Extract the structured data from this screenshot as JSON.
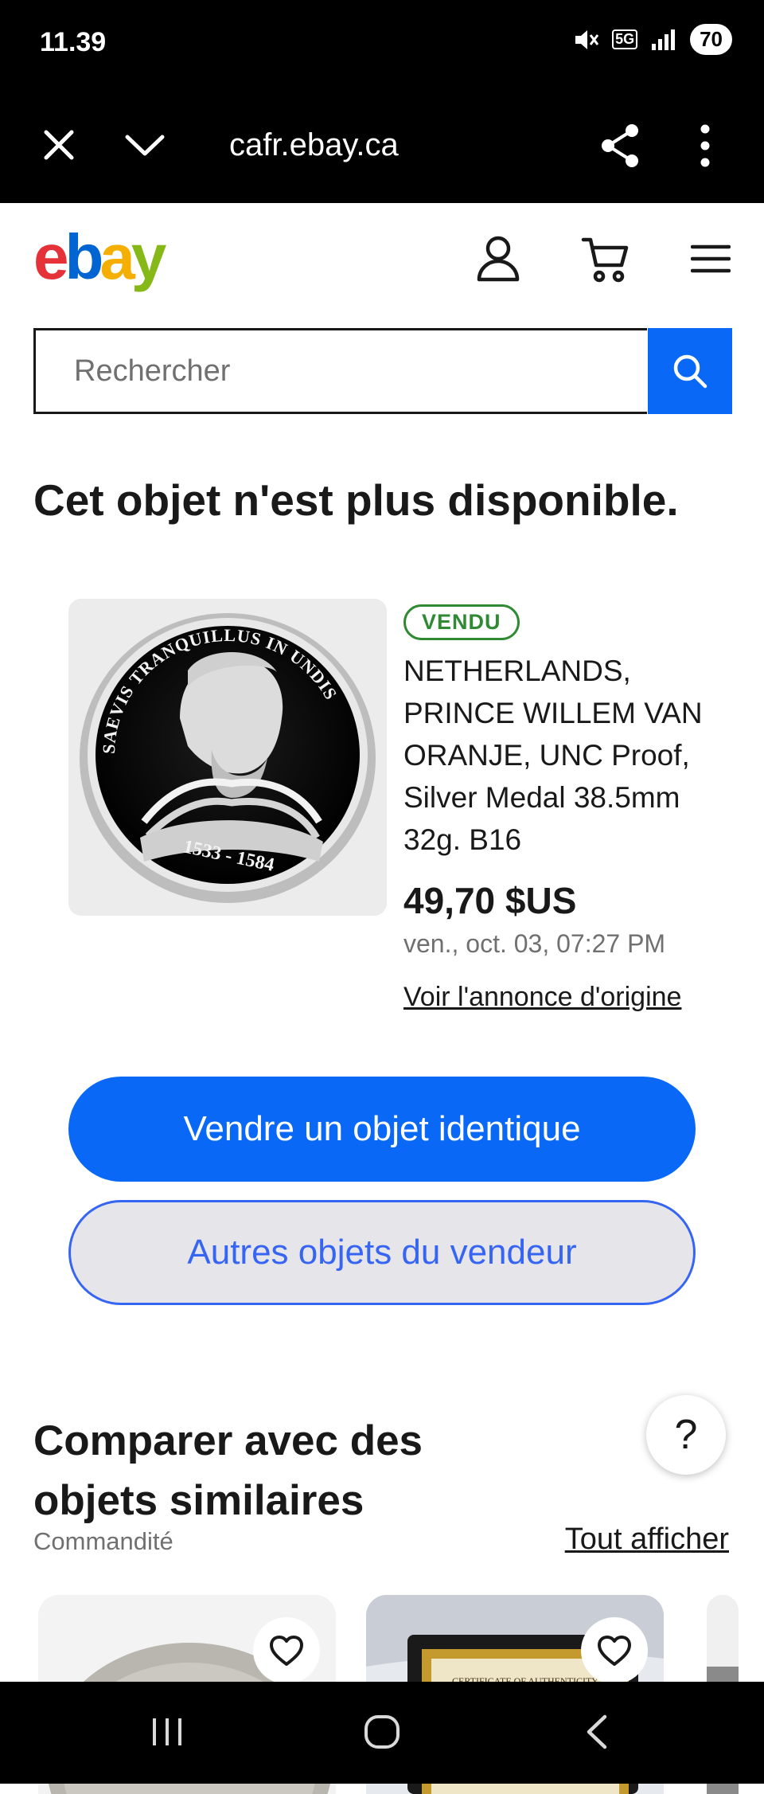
{
  "status_bar": {
    "time": "11.39",
    "network": "5G",
    "battery": "70"
  },
  "browser": {
    "url": "cafr.ebay.ca"
  },
  "header": {
    "logo": {
      "letters": [
        "e",
        "b",
        "a",
        "y"
      ],
      "colors": [
        "#e53238",
        "#0064d2",
        "#f5af02",
        "#86b817"
      ]
    }
  },
  "search": {
    "placeholder": "Rechercher"
  },
  "page": {
    "unavailable_title": "Cet objet n'est plus disponible."
  },
  "item": {
    "status_badge": "VENDU",
    "title": "NETHERLANDS, PRINCE WILLEM VAN ORANJE, UNC Proof, Silver Medal 38.5mm 32g. B16",
    "price": "49,70 $US",
    "date": "ven., oct. 03, 07:27 PM",
    "original_link": "Voir l'annonce d'origine",
    "medal_inscription": "SAEVIS TRANQUILLUS IN UNDIS",
    "medal_years": "1533 - 1584"
  },
  "actions": {
    "sell_label": "Vendre un objet identique",
    "seller_items_label": "Autres objets du vendeur"
  },
  "compare": {
    "title": "Comparer avec des objets similaires",
    "sponsored": "Commandité",
    "see_all": "Tout afficher",
    "help": "?",
    "card2_caption": "CERTIFICATE OF AUTHENTICITY"
  },
  "colors": {
    "primary_blue": "#0968f6",
    "sold_green": "#2f8a33",
    "outline_blue": "#3665f3"
  }
}
